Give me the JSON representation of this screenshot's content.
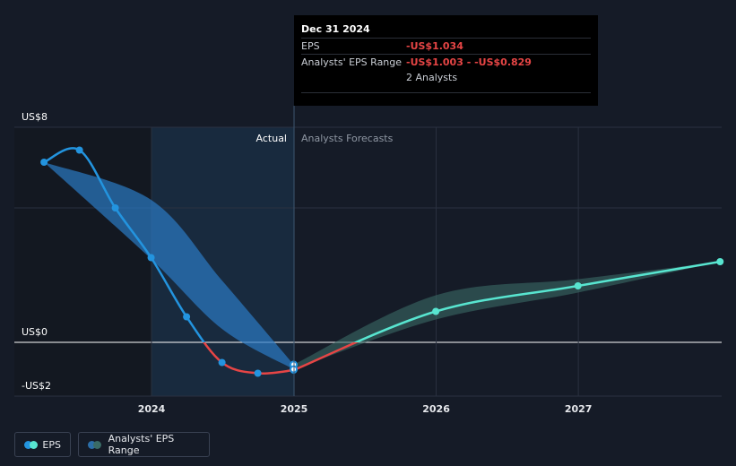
{
  "tooltip": {
    "date": "Dec 31 2024",
    "eps_label": "EPS",
    "eps_value": "-US$1.034",
    "range_label": "Analysts' EPS Range",
    "range_value": "-US$1.003 - -US$0.829",
    "analysts": "2 Analysts"
  },
  "section_labels": {
    "actual": "Actual",
    "forecast": "Analysts Forecasts"
  },
  "legend": {
    "eps": "EPS",
    "range": "Analysts' EPS Range"
  },
  "colors": {
    "eps_actual": "#2394df",
    "eps_negative": "#e64545",
    "eps_forecast": "#58e5d0",
    "range_actual": "#2b7bc4",
    "range_forecast": "#3a6b66",
    "background": "#151b27"
  },
  "chart_data": {
    "type": "line",
    "title": "",
    "xlabel": "",
    "ylabel": "",
    "ylim": [
      -2.05,
      8
    ],
    "x_ticks": [
      "2024",
      "2025",
      "2026",
      "2027"
    ],
    "y_tick_labels": [
      {
        "value": 8,
        "label": "US$8"
      },
      {
        "value": 0,
        "label": "US$0"
      },
      {
        "value": -2,
        "label": "-US$2"
      }
    ],
    "divider_date": "2024-12-31",
    "series": [
      {
        "name": "EPS",
        "points": [
          {
            "x": "2023-03-31",
            "y": 6.7
          },
          {
            "x": "2023-06-30",
            "y": 7.15
          },
          {
            "x": "2023-09-30",
            "y": 5.0
          },
          {
            "x": "2023-12-31",
            "y": 3.15
          },
          {
            "x": "2024-03-31",
            "y": 0.95
          },
          {
            "x": "2024-06-30",
            "y": -0.75
          },
          {
            "x": "2024-09-30",
            "y": -1.15
          },
          {
            "x": "2024-12-31",
            "y": -1.034
          },
          {
            "x": "2025-12-31",
            "y": 1.15
          },
          {
            "x": "2026-12-31",
            "y": 2.1
          },
          {
            "x": "2027-12-31",
            "y": 3.0
          }
        ]
      },
      {
        "name": "Analysts' EPS Range",
        "points": [
          {
            "x": "2023-03-31",
            "low": 6.7,
            "high": 6.7
          },
          {
            "x": "2023-12-31",
            "high": 5.3,
            "low": 3.1
          },
          {
            "x": "2024-06-30",
            "high": 2.3,
            "low": 0.5
          },
          {
            "x": "2024-12-31",
            "high": -0.829,
            "low": -1.003
          },
          {
            "x": "2025-12-31",
            "high": 1.75,
            "low": 0.85
          },
          {
            "x": "2026-12-31",
            "high": 2.35,
            "low": 1.85
          },
          {
            "x": "2027-12-31",
            "high": 3.0,
            "low": 3.0
          }
        ]
      }
    ]
  }
}
